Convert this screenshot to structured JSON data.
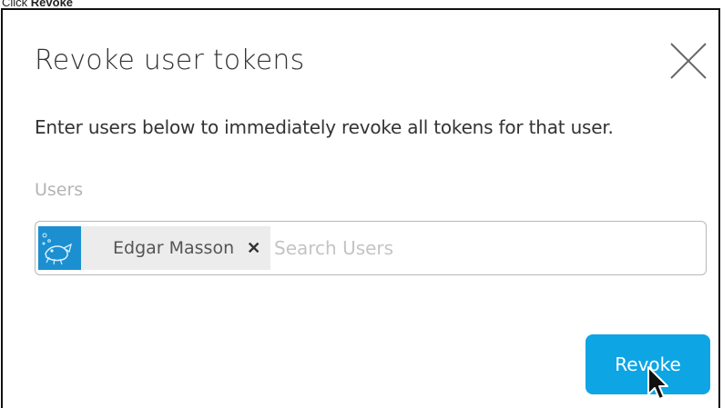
{
  "caption": {
    "prefix": "Click ",
    "bold": "Revoke"
  },
  "dialog": {
    "title": "Revoke user tokens",
    "close_icon": "close-icon",
    "description": "Enter users below to immediately revoke all tokens for that user.",
    "users_label": "Users",
    "selected_users": [
      {
        "name": "Edgar Masson",
        "avatar_icon": "user-avatar"
      }
    ],
    "search": {
      "placeholder": "Search Users",
      "value": ""
    },
    "revoke_button": "Revoke"
  },
  "colors": {
    "accent": "#0ea5e4",
    "avatar_bg": "#1b8fd0",
    "chip_bg": "#ececec",
    "label_muted": "#b4b4b4"
  }
}
